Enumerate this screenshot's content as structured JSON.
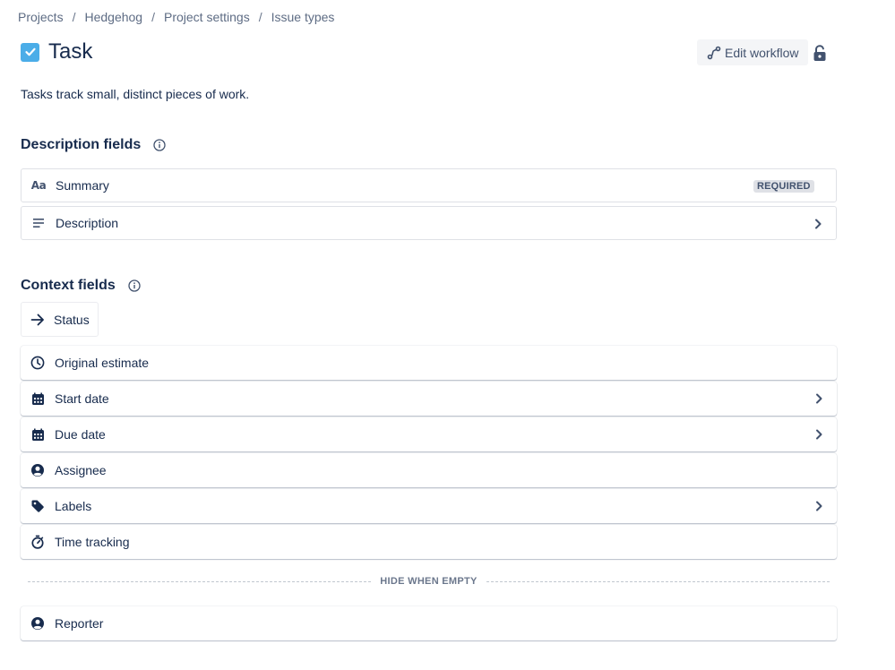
{
  "breadcrumb": [
    "Projects",
    "Hedgehog",
    "Project settings",
    "Issue types"
  ],
  "breadcrumb_separator": "/",
  "title": "Task",
  "task_icon_color": "#4bade8",
  "edit_workflow_label": "Edit workflow",
  "description": "Tasks track small, distinct pieces of work.",
  "description_fields": {
    "title": "Description fields",
    "items": [
      {
        "label": "Summary",
        "icon": "text-icon",
        "badge": "REQUIRED"
      },
      {
        "label": "Description",
        "icon": "align-left-icon",
        "chevron": true
      }
    ]
  },
  "context_fields": {
    "title": "Context fields",
    "status_label": "Status",
    "items": [
      {
        "label": "Original estimate",
        "icon": "clock-icon"
      },
      {
        "label": "Start date",
        "icon": "calendar-icon",
        "chevron": true
      },
      {
        "label": "Due date",
        "icon": "calendar-icon",
        "chevron": true
      },
      {
        "label": "Assignee",
        "icon": "person-icon"
      },
      {
        "label": "Labels",
        "icon": "tag-icon",
        "chevron": true
      },
      {
        "label": "Time tracking",
        "icon": "stopwatch-icon"
      }
    ]
  },
  "hide_when_empty_label": "HIDE WHEN EMPTY",
  "hidden_fields": [
    {
      "label": "Reporter",
      "icon": "person-icon"
    }
  ]
}
